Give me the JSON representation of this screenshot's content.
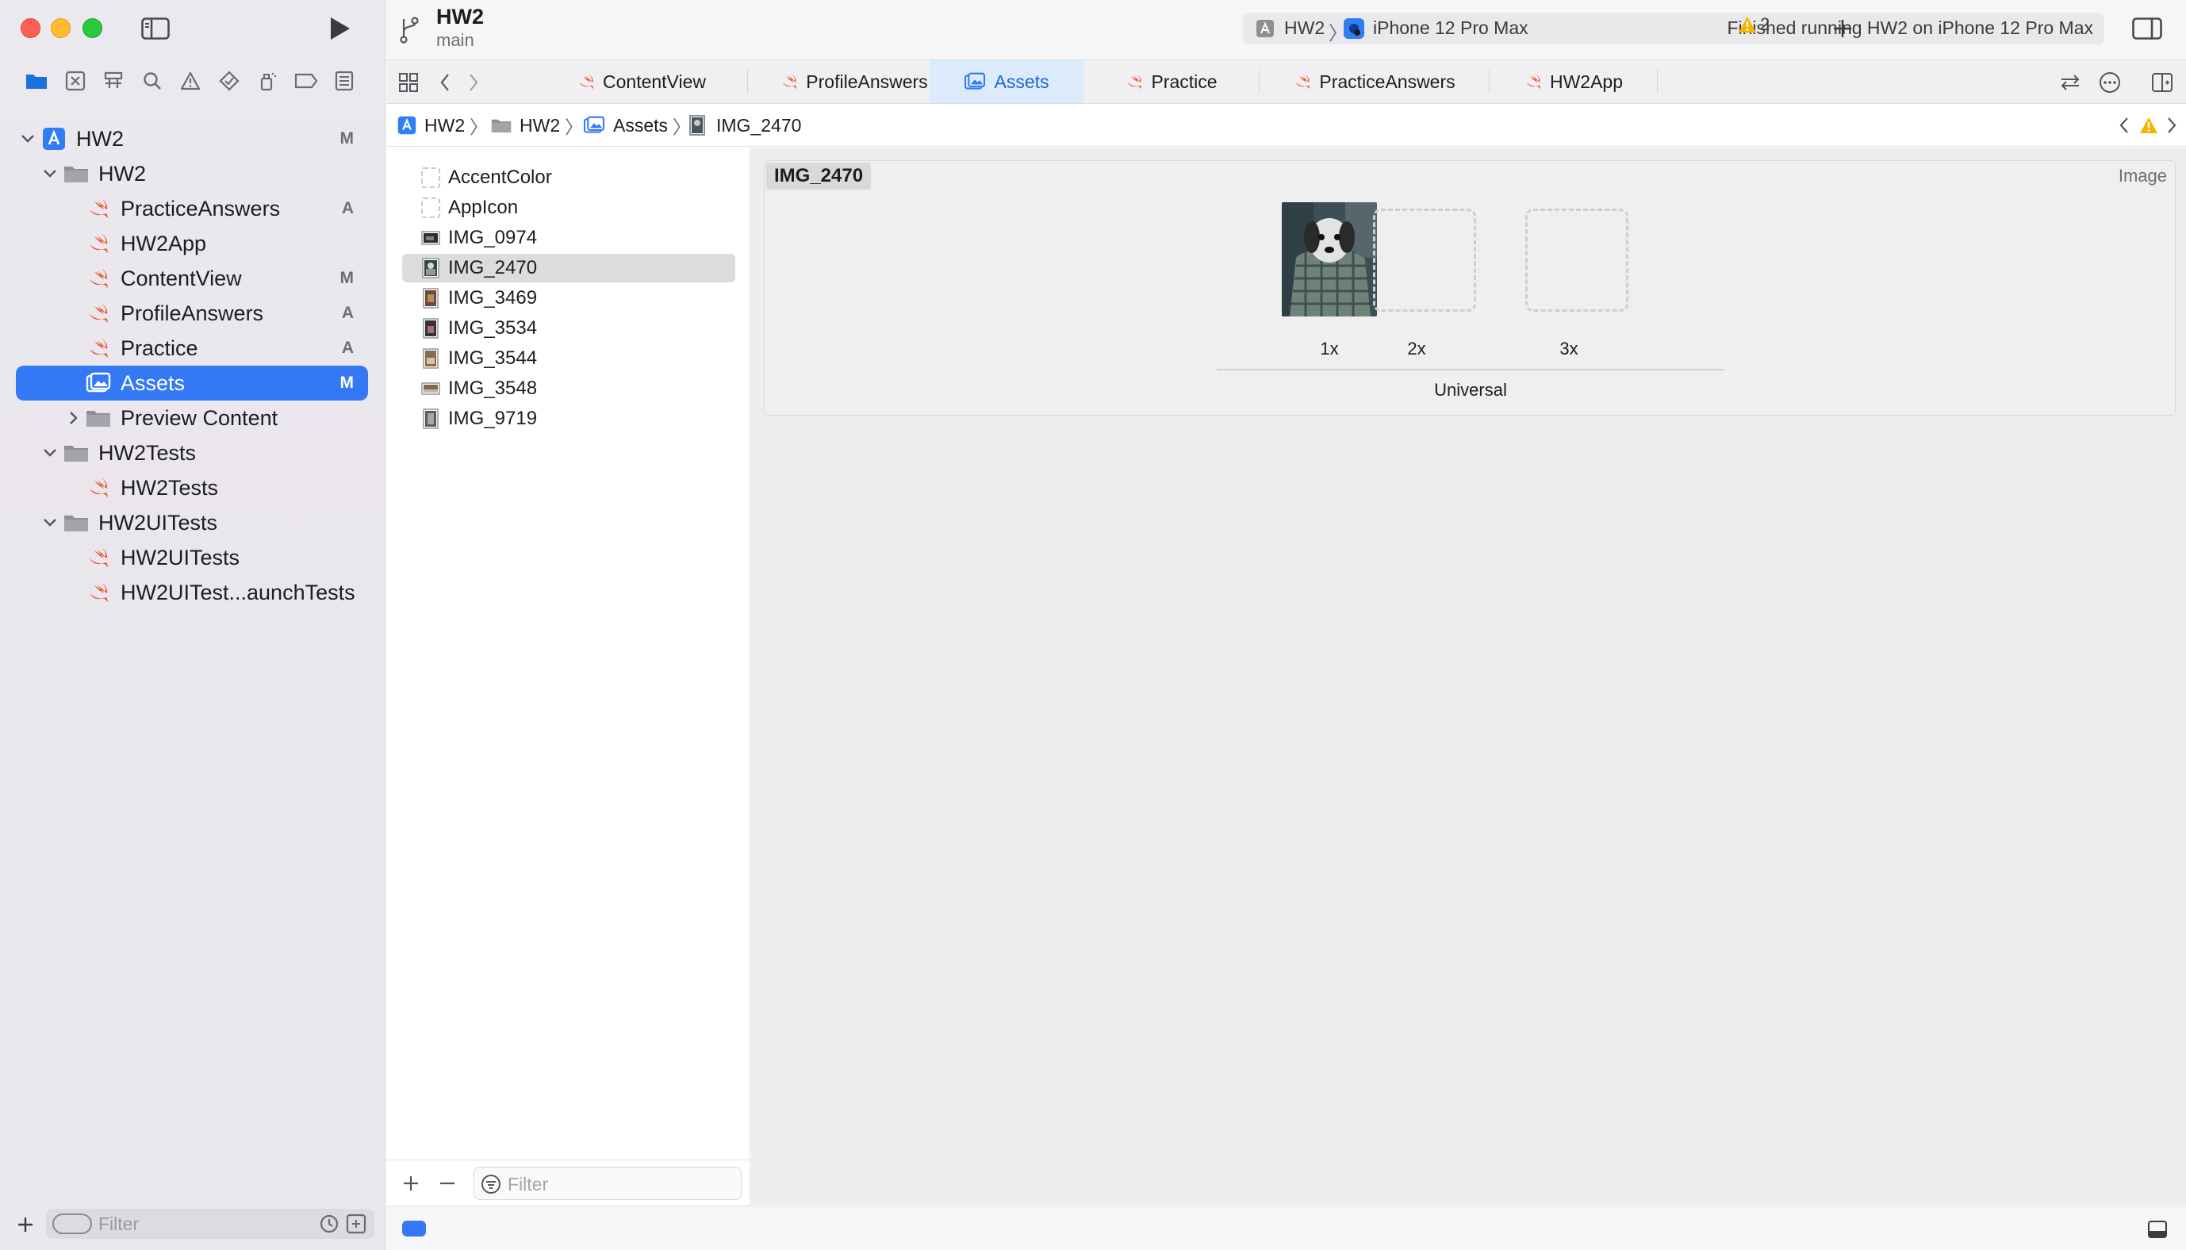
{
  "window": {
    "project_name": "HW2",
    "branch": "main"
  },
  "toolbar": {
    "scheme": "HW2",
    "destination": "iPhone 12 Pro Max",
    "status": "Finished running HW2 on iPhone 12 Pro Max",
    "warning_count": "2"
  },
  "tabs": [
    {
      "label": "ContentView",
      "active": false
    },
    {
      "label": "ProfileAnswers",
      "active": false
    },
    {
      "label": "Assets",
      "active": true
    },
    {
      "label": "Practice",
      "active": false
    },
    {
      "label": "PracticeAnswers",
      "active": false
    },
    {
      "label": "HW2App",
      "active": false
    }
  ],
  "breadcrumb": [
    "HW2",
    "HW2",
    "Assets",
    "IMG_2470"
  ],
  "navigator": {
    "items": [
      {
        "label": "HW2",
        "badge": "M",
        "type": "project"
      },
      {
        "label": "HW2",
        "badge": "",
        "type": "folder"
      },
      {
        "label": "PracticeAnswers",
        "badge": "A",
        "type": "swift"
      },
      {
        "label": "HW2App",
        "badge": "",
        "type": "swift"
      },
      {
        "label": "ContentView",
        "badge": "M",
        "type": "swift"
      },
      {
        "label": "ProfileAnswers",
        "badge": "A",
        "type": "swift"
      },
      {
        "label": "Practice",
        "badge": "A",
        "type": "swift"
      },
      {
        "label": "Assets",
        "badge": "M",
        "type": "assets"
      },
      {
        "label": "Preview Content",
        "badge": "",
        "type": "folder"
      },
      {
        "label": "HW2Tests",
        "badge": "",
        "type": "folder"
      },
      {
        "label": "HW2Tests",
        "badge": "",
        "type": "swift"
      },
      {
        "label": "HW2UITests",
        "badge": "",
        "type": "folder"
      },
      {
        "label": "HW2UITests",
        "badge": "",
        "type": "swift"
      },
      {
        "label": "HW2UITest...aunchTests",
        "badge": "",
        "type": "swift"
      }
    ],
    "filter_placeholder": "Filter"
  },
  "assets": {
    "items": [
      "AccentColor",
      "AppIcon",
      "IMG_0974",
      "IMG_2470",
      "IMG_3469",
      "IMG_3534",
      "IMG_3544",
      "IMG_3548",
      "IMG_9719"
    ],
    "selected": "IMG_2470",
    "filter_placeholder": "Filter"
  },
  "image_set": {
    "name": "IMG_2470",
    "type_label": "Image",
    "slots": [
      "1x",
      "2x",
      "3x"
    ],
    "idiom": "Universal"
  },
  "colors": {
    "accent": "#3478f6",
    "swift_icon": "#f05138",
    "warning": "#f5b400"
  }
}
